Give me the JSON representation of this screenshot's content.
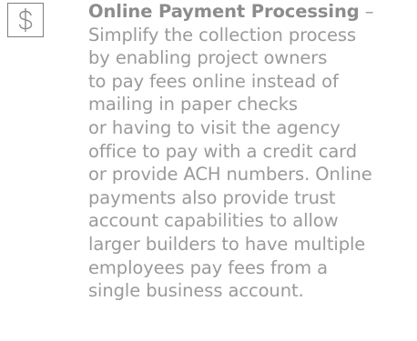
{
  "feature": {
    "icon": "dollar-sign-icon",
    "title": "Online Payment Processing",
    "separator": " –",
    "description_lines": [
      "Simplify the collection process",
      "by enabling project owners",
      "to pay fees online instead of",
      "mailing in paper checks",
      "or having to visit the agency",
      "office to pay with a credit card",
      "or provide ACH numbers. Online",
      "payments also provide trust",
      "account capabilities to allow",
      "larger builders to have multiple",
      "employees pay fees from a",
      "single business account."
    ]
  }
}
